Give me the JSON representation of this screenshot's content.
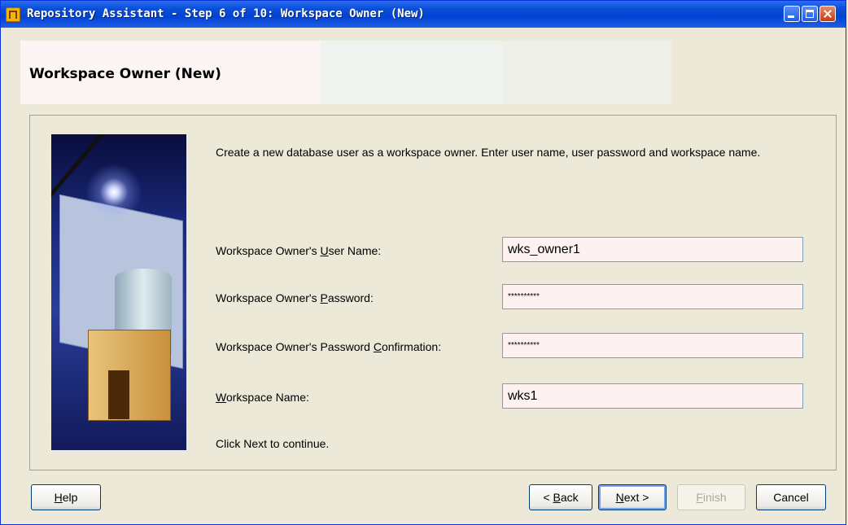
{
  "window": {
    "title": "Repository Assistant - Step 6 of 10: Workspace Owner (New)"
  },
  "header": {
    "title": "Workspace Owner (New)"
  },
  "content": {
    "description": "Create a new database user as a workspace owner. Enter user name, user password and workspace name.",
    "fields": [
      {
        "label_pre": "Workspace Owner's ",
        "mnemonic": "U",
        "label_post": "ser Name:",
        "value": "wks_owner1"
      },
      {
        "label_pre": "Workspace Owner's ",
        "mnemonic": "P",
        "label_post": "assword:",
        "value": "**********"
      },
      {
        "label_pre": "Workspace Owner's Password ",
        "mnemonic": "C",
        "label_post": "onfirmation:",
        "value": "**********"
      },
      {
        "label_pre": "",
        "mnemonic": "W",
        "label_post": "orkspace Name:",
        "value": "wks1"
      }
    ],
    "footer_text": "Click Next to continue."
  },
  "buttons": {
    "help": {
      "mnemonic": "H",
      "rest": "elp"
    },
    "back": {
      "pre": "< ",
      "mnemonic": "B",
      "rest": "ack"
    },
    "next": {
      "mnemonic": "N",
      "rest": "ext >"
    },
    "finish": {
      "mnemonic": "F",
      "rest": "inish"
    },
    "cancel": {
      "label": "Cancel"
    }
  },
  "colors": {
    "titlebar": "#0a4fd8",
    "input_bg": "#fdf1f1",
    "window_bg": "#ece9d8"
  }
}
